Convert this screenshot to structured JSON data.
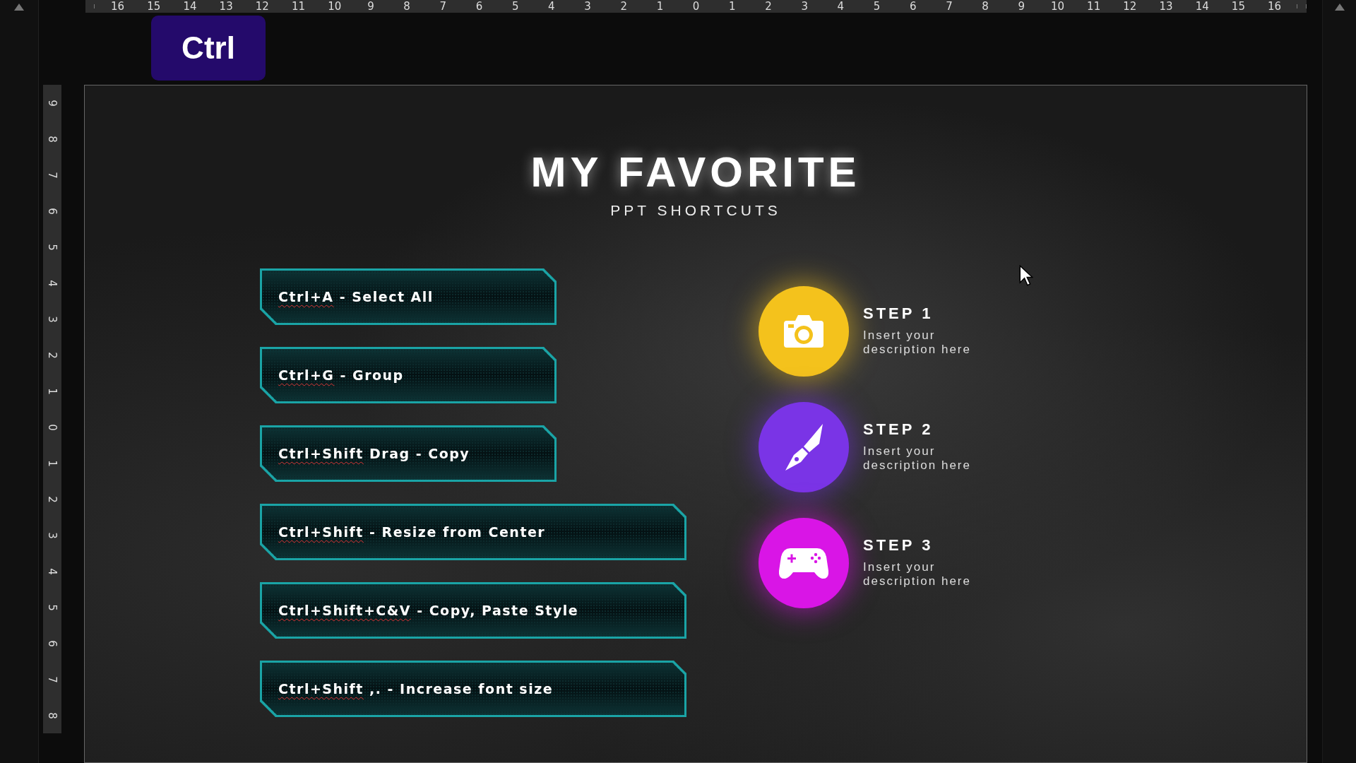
{
  "ruler_top": {
    "labels": [
      "16",
      "15",
      "14",
      "13",
      "12",
      "11",
      "10",
      "9",
      "8",
      "7",
      "6",
      "5",
      "4",
      "3",
      "2",
      "1",
      "0",
      "1",
      "2",
      "3",
      "4",
      "5",
      "6",
      "7",
      "8",
      "9",
      "10",
      "11",
      "12",
      "13",
      "14",
      "15",
      "16"
    ]
  },
  "ruler_left": {
    "labels": [
      "9",
      "8",
      "7",
      "6",
      "5",
      "4",
      "3",
      "2",
      "1",
      "0",
      "1",
      "2",
      "3",
      "4",
      "5",
      "6",
      "7",
      "8"
    ]
  },
  "key_overlay": {
    "label": "Ctrl"
  },
  "slide": {
    "title": "MY FAVORITE",
    "subtitle": "PPT SHORTCUTS",
    "shortcuts": [
      {
        "flagged": "Ctrl+A",
        "text": " - Select All",
        "kind": "short"
      },
      {
        "flagged": "Ctrl+G",
        "text": " - Group",
        "kind": "short"
      },
      {
        "flagged": "Ctrl+Shift",
        "text": " Drag - Copy",
        "kind": "short"
      },
      {
        "flagged": "Ctrl+Shift",
        "text": " - Resize from Center",
        "kind": "long"
      },
      {
        "flagged": "Ctrl+Shift+C&V",
        "text": " - Copy, Paste Style",
        "kind": "long"
      },
      {
        "flagged": "Ctrl+Shift",
        "text": " ,. - Increase font size",
        "kind": "long"
      }
    ],
    "steps": [
      {
        "title": "STEP 1",
        "description": "Insert your description here",
        "color": "#f4c21c"
      },
      {
        "title": "STEP 2",
        "description": "Insert your description here",
        "color": "#7a34e6"
      },
      {
        "title": "STEP 3",
        "description": "Insert your description here",
        "color": "#d915e6"
      }
    ]
  }
}
